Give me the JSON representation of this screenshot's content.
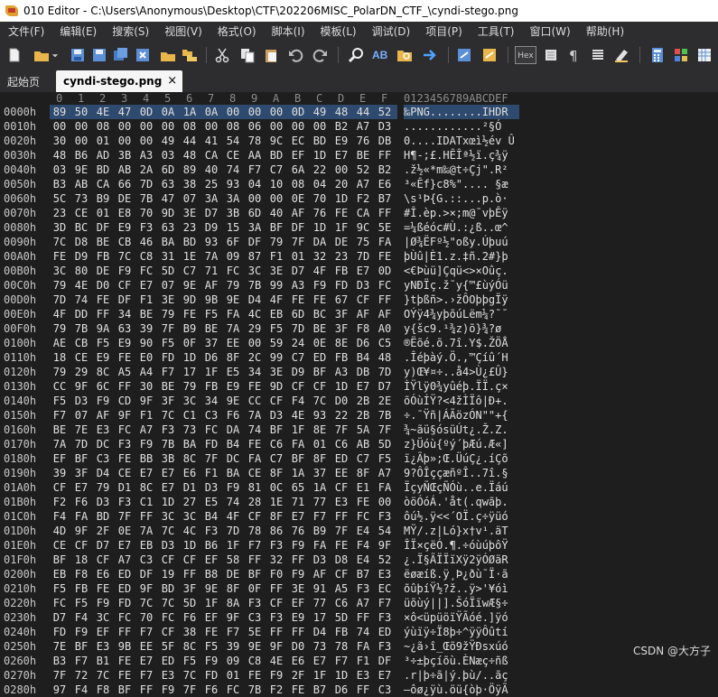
{
  "window": {
    "title": "010 Editor - C:\\Users\\Anonymous\\Desktop\\CTF\\202206MISC_PolarDN_CTF_\\cyndi-stego.png"
  },
  "menu": [
    "文件(F)",
    "编辑(E)",
    "搜索(S)",
    "视图(V)",
    "格式(O)",
    "脚本(I)",
    "模板(L)",
    "调试(D)",
    "项目(P)",
    "工具(T)",
    "窗口(W)",
    "帮助(H)"
  ],
  "toolbar": {
    "hex_label": "Hex"
  },
  "tabs": {
    "home": "起始页",
    "active": "cyndi-stego.png",
    "close": "×"
  },
  "ruler": {
    "columns": [
      "0",
      "1",
      "2",
      "3",
      "4",
      "5",
      "6",
      "7",
      "8",
      "9",
      "A",
      "B",
      "C",
      "D",
      "E",
      "F"
    ],
    "ascii": "0123456789ABCDEF"
  },
  "rows": [
    {
      "offset": "0000h",
      "hex": [
        "89",
        "50",
        "4E",
        "47",
        "0D",
        "0A",
        "1A",
        "0A",
        "00",
        "00",
        "00",
        "0D",
        "49",
        "48",
        "44",
        "52"
      ],
      "ascii": "‰PNG........IHDR"
    },
    {
      "offset": "0010h",
      "hex": [
        "00",
        "00",
        "08",
        "00",
        "00",
        "00",
        "08",
        "00",
        "08",
        "06",
        "00",
        "00",
        "00",
        "B2",
        "A7",
        "D3"
      ],
      "ascii": "............²§Ó"
    },
    {
      "offset": "0020h",
      "hex": [
        "30",
        "00",
        "01",
        "00",
        "00",
        "49",
        "44",
        "41",
        "54",
        "78",
        "9C",
        "EC",
        "BD",
        "E9",
        "76",
        "DB"
      ],
      "ascii": "0....IDATxœì½év Û"
    },
    {
      "offset": "0030h",
      "hex": [
        "48",
        "B6",
        "AD",
        "3B",
        "A3",
        "03",
        "48",
        "CA",
        "CE",
        "AA",
        "BD",
        "EF",
        "1D",
        "E7",
        "BE",
        "FF"
      ],
      "ascii": "H¶-;£.HÊÎª½ï.ç¾ÿ"
    },
    {
      "offset": "0040h",
      "hex": [
        "03",
        "9E",
        "BD",
        "AB",
        "2A",
        "6D",
        "89",
        "40",
        "74",
        "F7",
        "C7",
        "6A",
        "22",
        "00",
        "52",
        "B2"
      ],
      "ascii": ".ž½«*m‰@t÷Çj\".R²"
    },
    {
      "offset": "0050h",
      "hex": [
        "B3",
        "AB",
        "CA",
        "66",
        "7D",
        "63",
        "38",
        "25",
        "93",
        "04",
        "10",
        "08",
        "04",
        "20",
        "A7",
        "E6"
      ],
      "ascii": "³«Êf}c8%\".... §æ"
    },
    {
      "offset": "0060h",
      "hex": [
        "5C",
        "73",
        "B9",
        "DE",
        "7B",
        "47",
        "07",
        "3A",
        "3A",
        "00",
        "00",
        "0E",
        "70",
        "1D",
        "F2",
        "B7"
      ],
      "ascii": "\\s¹Þ{G.::...p.ò·"
    },
    {
      "offset": "0070h",
      "hex": [
        "23",
        "CE",
        "01",
        "E8",
        "70",
        "9D",
        "3E",
        "D7",
        "3B",
        "6D",
        "40",
        "AF",
        "76",
        "FE",
        "CA",
        "FF"
      ],
      "ascii": "#Î.èp.>×;m@¯vþÊÿ"
    },
    {
      "offset": "0080h",
      "hex": [
        "3D",
        "BC",
        "DF",
        "E9",
        "F3",
        "63",
        "23",
        "D9",
        "15",
        "3A",
        "BF",
        "DF",
        "1D",
        "1F",
        "9C",
        "5E"
      ],
      "ascii": "=¼ßéóc#Ù.:¿ß..œ^"
    },
    {
      "offset": "0090h",
      "hex": [
        "7C",
        "D8",
        "BE",
        "CB",
        "46",
        "BA",
        "BD",
        "93",
        "6F",
        "DF",
        "79",
        "7F",
        "DA",
        "DE",
        "75",
        "FA"
      ],
      "ascii": "|Ø¾ËFº½\"oßy.Úþuú"
    },
    {
      "offset": "00A0h",
      "hex": [
        "FE",
        "D9",
        "FB",
        "7C",
        "C8",
        "31",
        "1E",
        "7A",
        "09",
        "87",
        "F1",
        "01",
        "32",
        "23",
        "7D",
        "FE"
      ],
      "ascii": "þÙû|È1.z.‡ñ.2#}þ"
    },
    {
      "offset": "00B0h",
      "hex": [
        "3C",
        "80",
        "DE",
        "F9",
        "FC",
        "5D",
        "C7",
        "71",
        "FC",
        "3C",
        "3E",
        "D7",
        "4F",
        "FB",
        "E7",
        "0D"
      ],
      "ascii": "<€Þùü]Çqü<>×Oûç."
    },
    {
      "offset": "00C0h",
      "hex": [
        "79",
        "4E",
        "D0",
        "CF",
        "E7",
        "07",
        "9E",
        "AF",
        "79",
        "7B",
        "99",
        "A3",
        "F9",
        "FD",
        "D3",
        "FC"
      ],
      "ascii": "yNÐÏç.ž¯y{™£ùýÓü"
    },
    {
      "offset": "00D0h",
      "hex": [
        "7D",
        "74",
        "FE",
        "DF",
        "F1",
        "3E",
        "9D",
        "9B",
        "9E",
        "D4",
        "4F",
        "FE",
        "FE",
        "67",
        "CF",
        "FF"
      ],
      "ascii": "}tþßñ>.›žÔOþþgÏÿ"
    },
    {
      "offset": "00E0h",
      "hex": [
        "4F",
        "DD",
        "FF",
        "34",
        "BE",
        "79",
        "FE",
        "F5",
        "FA",
        "4C",
        "EB",
        "6D",
        "BC",
        "3F",
        "AF",
        "AF"
      ],
      "ascii": "OÝÿ4¾yþõúLëm¼?¯¯"
    },
    {
      "offset": "00F0h",
      "hex": [
        "79",
        "7B",
        "9A",
        "63",
        "39",
        "7F",
        "B9",
        "BE",
        "7A",
        "29",
        "F5",
        "7D",
        "BE",
        "3F",
        "F8",
        "A0"
      ],
      "ascii": "y{šc9.¹¾z)õ}¾?ø "
    },
    {
      "offset": "0100h",
      "hex": [
        "AE",
        "CB",
        "F5",
        "E9",
        "90",
        "F5",
        "0F",
        "37",
        "EE",
        "00",
        "59",
        "24",
        "0E",
        "8E",
        "D6",
        "C5"
      ],
      "ascii": "®Ëõé.õ.7î.Y$.ŽÖÅ"
    },
    {
      "offset": "0110h",
      "hex": [
        "18",
        "CE",
        "E9",
        "FE",
        "E0",
        "FD",
        "1D",
        "D6",
        "8F",
        "2C",
        "99",
        "C7",
        "ED",
        "FB",
        "B4",
        "48"
      ],
      "ascii": ".Îéþàý.Ö.,™Çíû´H"
    },
    {
      "offset": "0120h",
      "hex": [
        "79",
        "29",
        "8C",
        "A5",
        "A4",
        "F7",
        "17",
        "1F",
        "E5",
        "34",
        "3E",
        "D9",
        "BF",
        "A3",
        "DB",
        "7D"
      ],
      "ascii": "y)Œ¥¤÷..å4>Ù¿£Û}"
    },
    {
      "offset": "0130h",
      "hex": [
        "CC",
        "9F",
        "6C",
        "FF",
        "30",
        "BE",
        "79",
        "FB",
        "E9",
        "FE",
        "9D",
        "CF",
        "CF",
        "1D",
        "E7",
        "D7"
      ],
      "ascii": "ÌŸlÿ0¾yûéþ.ÏÏ.ç×"
    },
    {
      "offset": "0140h",
      "hex": [
        "F5",
        "D3",
        "F9",
        "CD",
        "9F",
        "3F",
        "3C",
        "34",
        "9E",
        "CC",
        "CF",
        "F4",
        "7C",
        "D0",
        "2B",
        "2E"
      ],
      "ascii": "õÓùÍŸ?<4žÌÏô|Ð+."
    },
    {
      "offset": "0150h",
      "hex": [
        "F7",
        "07",
        "AF",
        "9F",
        "F1",
        "7C",
        "C1",
        "C3",
        "F6",
        "7A",
        "D3",
        "4E",
        "93",
        "22",
        "2B",
        "7B"
      ],
      "ascii": "÷.¯Ÿñ|ÁÃözÓN\"\"+{"
    },
    {
      "offset": "0160h",
      "hex": [
        "BE",
        "7E",
        "E3",
        "FC",
        "A7",
        "F3",
        "73",
        "FC",
        "DA",
        "74",
        "BF",
        "1F",
        "8E",
        "7F",
        "5A",
        "7F"
      ],
      "ascii": "¾~ãü§ósüÚt¿.Ž.Z."
    },
    {
      "offset": "0170h",
      "hex": [
        "7A",
        "7D",
        "DC",
        "F3",
        "F9",
        "7B",
        "BA",
        "FD",
        "B4",
        "FE",
        "C6",
        "FA",
        "01",
        "C6",
        "AB",
        "5D"
      ],
      "ascii": "z}Üóù{ºý´þÆú.Æ«]"
    },
    {
      "offset": "0180h",
      "hex": [
        "EF",
        "BF",
        "C3",
        "FE",
        "BB",
        "3B",
        "8C",
        "7F",
        "DC",
        "FA",
        "C7",
        "BF",
        "8F",
        "ED",
        "C7",
        "F5"
      ],
      "ascii": "ï¿Ãþ»;Œ.ÜúÇ¿.íÇõ"
    },
    {
      "offset": "0190h",
      "hex": [
        "39",
        "3F",
        "D4",
        "CE",
        "E7",
        "E7",
        "E6",
        "F1",
        "BA",
        "CE",
        "8F",
        "1A",
        "37",
        "EE",
        "8F",
        "A7"
      ],
      "ascii": "9?ÔÎççæñºÎ..7î.§"
    },
    {
      "offset": "01A0h",
      "hex": [
        "CF",
        "E7",
        "79",
        "D1",
        "8C",
        "E7",
        "D1",
        "D3",
        "F9",
        "81",
        "0C",
        "65",
        "1A",
        "CF",
        "E1",
        "FA"
      ],
      "ascii": "ÏçyÑŒçÑÓù..e.Ïáú"
    },
    {
      "offset": "01B0h",
      "hex": [
        "F2",
        "F6",
        "D3",
        "F3",
        "C1",
        "1D",
        "27",
        "E5",
        "74",
        "28",
        "1E",
        "71",
        "77",
        "E3",
        "FE",
        "00"
      ],
      "ascii": "òöÓóÁ.'åt(.qwãþ."
    },
    {
      "offset": "01C0h",
      "hex": [
        "F4",
        "FA",
        "BD",
        "7F",
        "FF",
        "3C",
        "3C",
        "B4",
        "4F",
        "CF",
        "8F",
        "E7",
        "F7",
        "FF",
        "FC",
        "F3"
      ],
      "ascii": "ôú½.ÿ<<´OÏ.ç÷ÿüó"
    },
    {
      "offset": "01D0h",
      "hex": [
        "4D",
        "9F",
        "2F",
        "0E",
        "7A",
        "7C",
        "4C",
        "F3",
        "7D",
        "78",
        "86",
        "76",
        "B9",
        "7F",
        "E4",
        "54"
      ],
      "ascii": "MŸ/.z|Ló}x†v¹.äT"
    },
    {
      "offset": "01E0h",
      "hex": [
        "CE",
        "CF",
        "D7",
        "E7",
        "EB",
        "D3",
        "1D",
        "B6",
        "1F",
        "F7",
        "F3",
        "F9",
        "FA",
        "FE",
        "F4",
        "9F"
      ],
      "ascii": "ÎÏ×çëÓ.¶.÷óùúþôŸ"
    },
    {
      "offset": "01F0h",
      "hex": [
        "BF",
        "18",
        "CF",
        "A7",
        "C3",
        "CF",
        "CF",
        "EF",
        "58",
        "FF",
        "32",
        "FF",
        "D3",
        "D8",
        "E4",
        "52"
      ],
      "ascii": "¿.Ï§ÃÏÏïXÿ2ÿÓØäR"
    },
    {
      "offset": "0200h",
      "hex": [
        "EB",
        "F8",
        "E6",
        "ED",
        "DF",
        "19",
        "FF",
        "B8",
        "DE",
        "BF",
        "F0",
        "F9",
        "AF",
        "CF",
        "B7",
        "E3"
      ],
      "ascii": "ëøæíß.ÿ¸Þ¿ðù¯Ï·ã"
    },
    {
      "offset": "0210h",
      "hex": [
        "F5",
        "FB",
        "FE",
        "ED",
        "9F",
        "BD",
        "3F",
        "9E",
        "8F",
        "0F",
        "FF",
        "3E",
        "91",
        "A5",
        "F3",
        "EC"
      ],
      "ascii": "õûþíŸ½?ž..ÿ>'¥óì"
    },
    {
      "offset": "0220h",
      "hex": [
        "FC",
        "F5",
        "F9",
        "FD",
        "7C",
        "7C",
        "5D",
        "1F",
        "8A",
        "F3",
        "CF",
        "EF",
        "77",
        "C6",
        "A7",
        "F7"
      ],
      "ascii": "üõùý||].ŠóÏïwÆ§÷"
    },
    {
      "offset": "0230h",
      "hex": [
        "D7",
        "F4",
        "3C",
        "FC",
        "70",
        "FC",
        "F6",
        "EF",
        "9F",
        "C3",
        "F3",
        "E9",
        "17",
        "5D",
        "FF",
        "F3"
      ],
      "ascii": "×ô<üpüöïŸÃóé.]ÿó"
    },
    {
      "offset": "0240h",
      "hex": [
        "FD",
        "F9",
        "EF",
        "FF",
        "F7",
        "CF",
        "38",
        "FE",
        "F7",
        "5E",
        "FF",
        "FF",
        "D4",
        "FB",
        "74",
        "ED"
      ],
      "ascii": "ýùïÿ÷Ï8þ÷^ÿÿÔûtí"
    },
    {
      "offset": "0250h",
      "hex": [
        "7E",
        "BF",
        "E3",
        "9B",
        "EE",
        "5F",
        "8C",
        "F5",
        "39",
        "9E",
        "9F",
        "D0",
        "73",
        "78",
        "FA",
        "F3"
      ],
      "ascii": "~¿ã›î_Œõ9žŸÐsxúó"
    },
    {
      "offset": "0260h",
      "hex": [
        "B3",
        "F7",
        "B1",
        "FE",
        "E7",
        "ED",
        "F5",
        "F9",
        "09",
        "C8",
        "4E",
        "E6",
        "E7",
        "F7",
        "F1",
        "DF"
      ],
      "ascii": "³÷±þçíõù.ÈNæç÷ñß"
    },
    {
      "offset": "0270h",
      "hex": [
        "7F",
        "72",
        "7C",
        "FE",
        "F7",
        "E3",
        "7C",
        "FD",
        "01",
        "FE",
        "F9",
        "2F",
        "1F",
        "1D",
        "E3",
        "E7"
      ],
      "ascii": ".r|þ÷ã|ý.þù/..ãç"
    },
    {
      "offset": "0280h",
      "hex": [
        "97",
        "F4",
        "F8",
        "BF",
        "FF",
        "F9",
        "7F",
        "F6",
        "FC",
        "7B",
        "F2",
        "FE",
        "B7",
        "D6",
        "FF",
        "C3"
      ],
      "ascii": "—ôø¿ÿù.öü{òþ·ÖÿÃ"
    }
  ],
  "watermark": "CSDN @大方子",
  "colors": {
    "background": "#1e1e1e",
    "chrome": "#2d2d30",
    "selection": "#2e4a6e",
    "offset_text": "#c8c8c8"
  }
}
